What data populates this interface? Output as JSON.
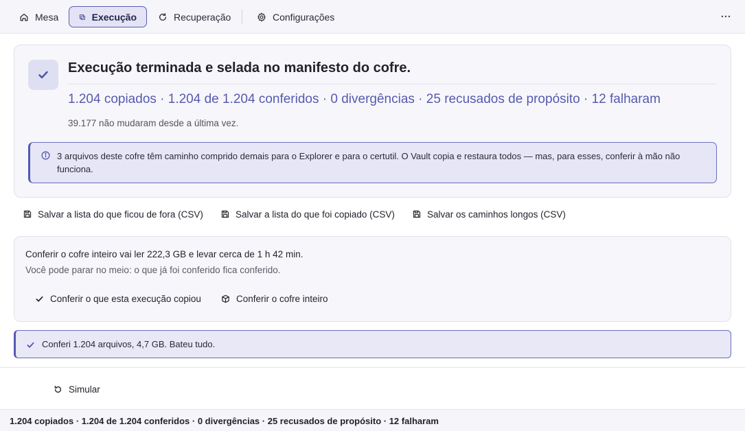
{
  "tabs": [
    {
      "label": "Mesa",
      "icon": "home-icon",
      "active": false
    },
    {
      "label": "Execução",
      "icon": "copy-icon",
      "active": true
    },
    {
      "label": "Recuperação",
      "icon": "refresh-icon",
      "active": false
    },
    {
      "label": "Configurações",
      "icon": "settings-icon",
      "active": false
    }
  ],
  "more_icon": "more-horizontal-icon",
  "result": {
    "title": "Execução terminada e selada no manifesto do cofre.",
    "summary": "1.204 copiados · 1.204 de 1.204 conferidos · 0 divergências · 25 recusados de propósito · 12 falharam",
    "unchanged": "39.177 não mudaram desde a última vez.",
    "notice": "3 arquivos deste cofre têm caminho comprido demais para o Explorer e para o certutil. O Vault copia e restaura todos — mas, para esses, conferir à mão não funciona."
  },
  "csv_buttons": [
    "Salvar a lista do que ficou de fora (CSV)",
    "Salvar a lista do que foi copiado (CSV)",
    "Salvar os caminhos longos (CSV)"
  ],
  "verify": {
    "line1": "Conferir o cofre inteiro vai ler 222,3 GB e levar cerca de 1 h 42 min.",
    "line2": "Você pode parar no meio: o que já foi conferido fica conferido.",
    "run_button": "Conferir o que esta execução copiou",
    "vault_button": "Conferir o cofre inteiro"
  },
  "success": "Conferi 1.204 arquivos, 4,7 GB. Bateu tudo.",
  "simulate_label": "Simular",
  "status": "1.204 copiados · 1.204 de 1.204 conferidos · 0 divergências · 25 recusados de propósito · 12 falharam",
  "colors": {
    "accent": "#5558b0",
    "accent_bg": "#e6e6f6",
    "card_bg": "#f7f7fb"
  }
}
